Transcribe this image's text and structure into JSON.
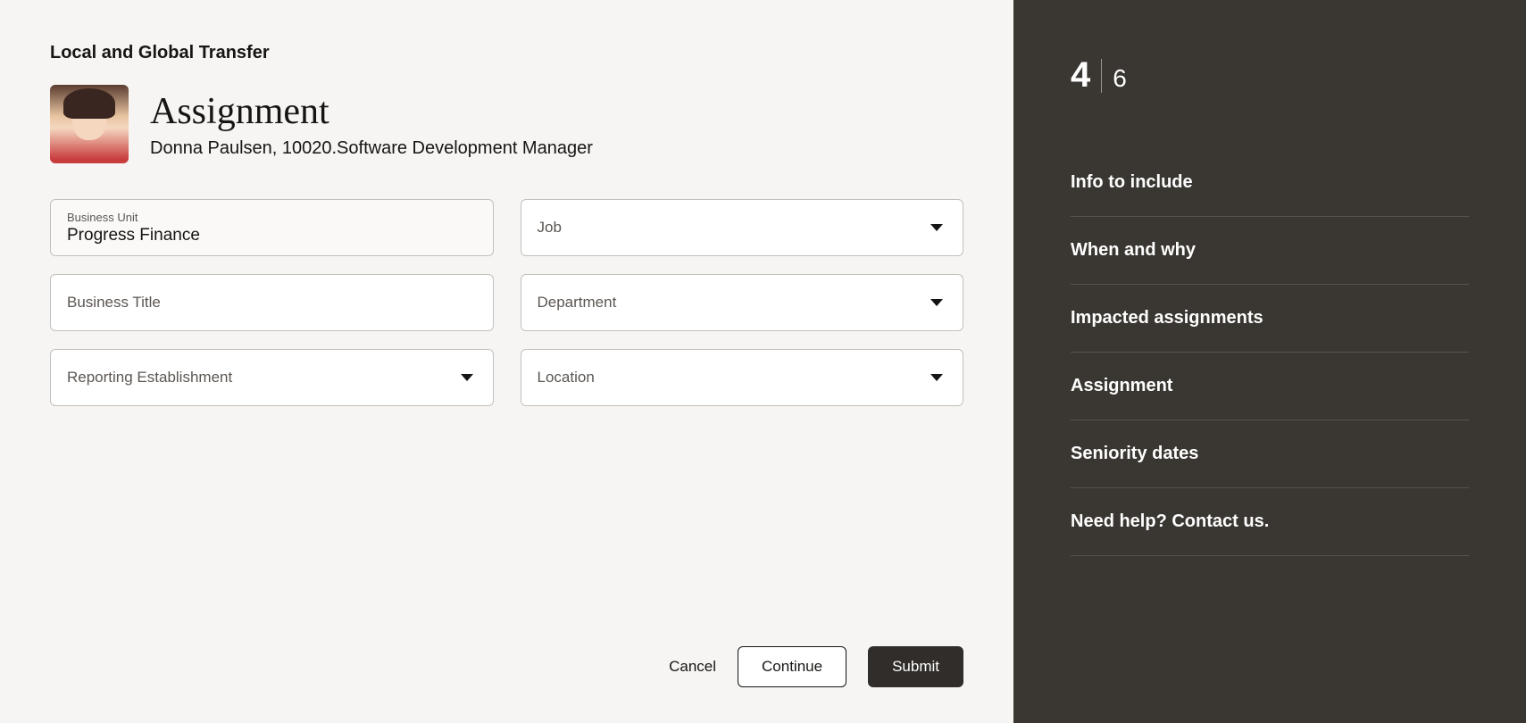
{
  "page_title": "Local and Global Transfer",
  "section_title": "Assignment",
  "person": {
    "name": "Donna Paulsen",
    "id": "10020",
    "role": "Software Development Manager",
    "subtitle": "Donna Paulsen, 10020.Software Development Manager"
  },
  "fields": {
    "business_unit": {
      "label": "Business Unit",
      "value": "Progress Finance"
    },
    "job": {
      "label": "Job",
      "value": ""
    },
    "business_title": {
      "label": "Business Title",
      "value": ""
    },
    "department": {
      "label": "Department",
      "value": ""
    },
    "reporting_establishment": {
      "label": "Reporting Establishment",
      "value": ""
    },
    "location": {
      "label": "Location",
      "value": ""
    }
  },
  "actions": {
    "cancel": "Cancel",
    "continue": "Continue",
    "submit": "Submit"
  },
  "sidebar": {
    "step_current": "4",
    "step_total": "6",
    "items": [
      {
        "label": "Info to include",
        "active": false
      },
      {
        "label": "When and why",
        "active": false
      },
      {
        "label": "Impacted assignments",
        "active": false
      },
      {
        "label": "Assignment",
        "active": true
      },
      {
        "label": "Seniority dates",
        "active": false
      },
      {
        "label": "Need help? Contact us.",
        "active": false
      }
    ]
  }
}
